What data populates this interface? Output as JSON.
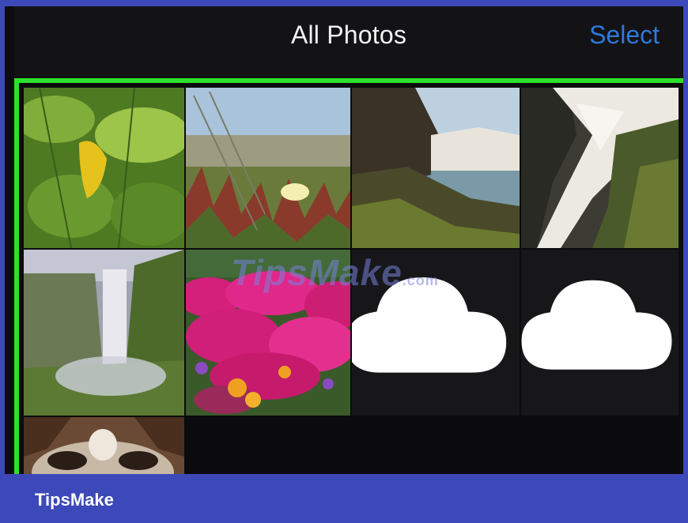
{
  "header": {
    "title": "All Photos",
    "select_label": "Select"
  },
  "photos": [
    {
      "subject": "green leaves with yellow leaf",
      "icon": "none"
    },
    {
      "subject": "white flower in grass by sea",
      "icon": "none"
    },
    {
      "subject": "waterfall over rocky cliff",
      "icon": "none"
    },
    {
      "subject": "long-exposure waterfall over rocks",
      "icon": "none"
    },
    {
      "subject": "tall misty waterfall in green valley",
      "icon": "none"
    },
    {
      "subject": "magenta and orange flowers",
      "icon": "none"
    },
    {
      "subject": "placeholder - not downloaded",
      "icon": "cloud-icon"
    },
    {
      "subject": "placeholder - not downloaded",
      "icon": "cloud-icon"
    },
    {
      "subject": "dog face (partially visible)",
      "icon": "none"
    }
  ],
  "watermark": {
    "text": "TipsMake",
    "suffix": ".com"
  },
  "footer": {
    "brand": "TipsMake"
  },
  "colors": {
    "accent": "#2f79d8",
    "highlight": "#2de02d",
    "frame": "#3d49b8"
  }
}
